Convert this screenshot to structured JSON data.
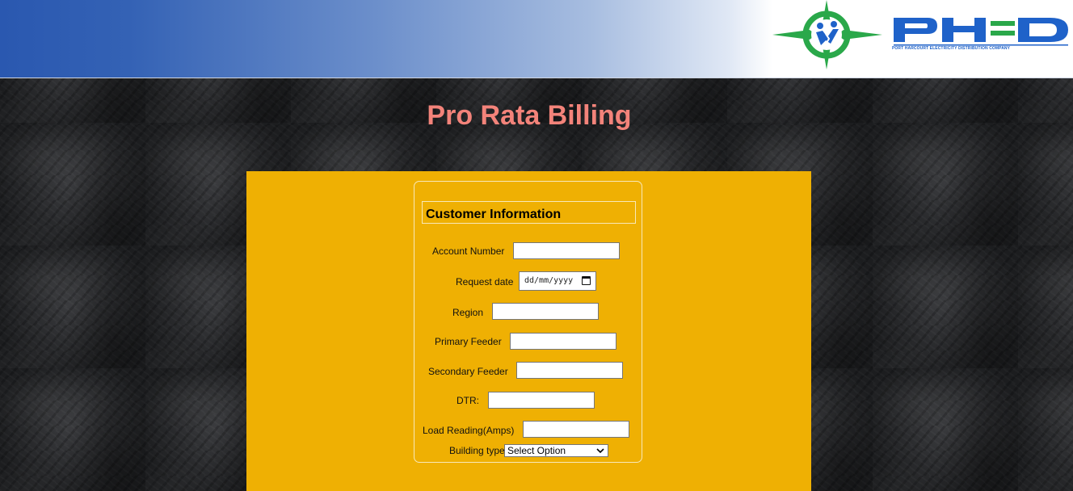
{
  "header": {
    "logo_text": "PHED",
    "logo_tagline": "PORT HARCOURT ELECTRICITY DISTRIBUTION COMPANY",
    "colors": {
      "gradient_start": "#2a58b0",
      "logo_blue": "#1f62c9",
      "logo_green": "#2aa84a"
    }
  },
  "page": {
    "title": "Pro Rata Billing",
    "title_color": "#f3837a"
  },
  "form": {
    "panel_color": "#efb003",
    "legend": "Customer Information",
    "account_number": {
      "label": "Account Number",
      "value": ""
    },
    "request_date": {
      "label": "Request date",
      "placeholder": "dd/mm/yyyy"
    },
    "region": {
      "label": "Region",
      "value": ""
    },
    "primary_feeder": {
      "label": "Primary Feeder",
      "value": ""
    },
    "secondary_feeder": {
      "label": "Secondary Feeder",
      "value": ""
    },
    "dtr": {
      "label": "DTR:",
      "value": ""
    },
    "load_reading": {
      "label": "Load Reading(Amps)",
      "value": ""
    },
    "building_type": {
      "label": "Building type",
      "selected": "Select Option"
    }
  }
}
